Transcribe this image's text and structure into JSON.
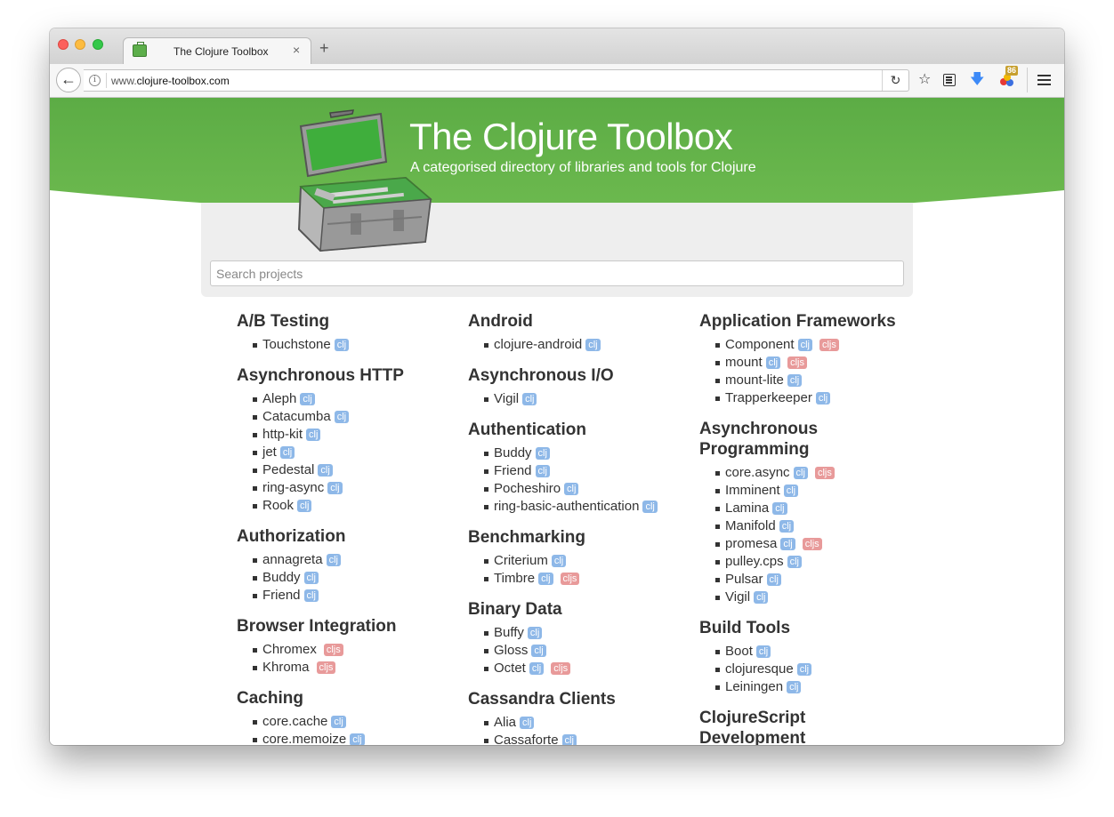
{
  "browser": {
    "tab_title": "The Clojure Toolbox",
    "tab_close": "×",
    "new_tab": "+",
    "url_prefix": "www.",
    "url_domain": "clojure-toolbox.com",
    "extension_badge": "86"
  },
  "banner": {
    "title": "The Clojure Toolbox",
    "subtitle": "A categorised directory of libraries and tools for Clojure",
    "green": "#67b54b"
  },
  "search": {
    "placeholder": "Search projects"
  },
  "tag_colors": {
    "clj": "#8eb8e8",
    "cljs": "#e89a9a"
  },
  "columns": [
    [
      {
        "title": "A/B Testing",
        "projects": [
          {
            "name": "Touchstone",
            "tags": [
              "clj"
            ]
          }
        ]
      },
      {
        "title": "Asynchronous HTTP",
        "projects": [
          {
            "name": "Aleph",
            "tags": [
              "clj"
            ]
          },
          {
            "name": "Catacumba",
            "tags": [
              "clj"
            ]
          },
          {
            "name": "http-kit",
            "tags": [
              "clj"
            ]
          },
          {
            "name": "jet",
            "tags": [
              "clj"
            ]
          },
          {
            "name": "Pedestal",
            "tags": [
              "clj"
            ]
          },
          {
            "name": "ring-async",
            "tags": [
              "clj"
            ]
          },
          {
            "name": "Rook",
            "tags": [
              "clj"
            ]
          }
        ]
      },
      {
        "title": "Authorization",
        "projects": [
          {
            "name": "annagreta",
            "tags": [
              "clj"
            ]
          },
          {
            "name": "Buddy",
            "tags": [
              "clj"
            ]
          },
          {
            "name": "Friend",
            "tags": [
              "clj"
            ]
          }
        ]
      },
      {
        "title": "Browser Integration",
        "projects": [
          {
            "name": "Chromex",
            "tags": [
              "cljs"
            ]
          },
          {
            "name": "Khroma",
            "tags": [
              "cljs"
            ]
          }
        ]
      },
      {
        "title": "Caching",
        "projects": [
          {
            "name": "core.cache",
            "tags": [
              "clj"
            ]
          },
          {
            "name": "core.memoize",
            "tags": [
              "clj"
            ]
          }
        ]
      }
    ],
    [
      {
        "title": "Android",
        "projects": [
          {
            "name": "clojure-android",
            "tags": [
              "clj"
            ]
          }
        ]
      },
      {
        "title": "Asynchronous I/O",
        "projects": [
          {
            "name": "Vigil",
            "tags": [
              "clj"
            ]
          }
        ]
      },
      {
        "title": "Authentication",
        "projects": [
          {
            "name": "Buddy",
            "tags": [
              "clj"
            ]
          },
          {
            "name": "Friend",
            "tags": [
              "clj"
            ]
          },
          {
            "name": "Pocheshiro",
            "tags": [
              "clj"
            ]
          },
          {
            "name": "ring-basic-authentication",
            "tags": [
              "clj"
            ]
          }
        ]
      },
      {
        "title": "Benchmarking",
        "projects": [
          {
            "name": "Criterium",
            "tags": [
              "clj"
            ]
          },
          {
            "name": "Timbre",
            "tags": [
              "clj",
              "cljs"
            ]
          }
        ]
      },
      {
        "title": "Binary Data",
        "projects": [
          {
            "name": "Buffy",
            "tags": [
              "clj"
            ]
          },
          {
            "name": "Gloss",
            "tags": [
              "clj"
            ]
          },
          {
            "name": "Octet",
            "tags": [
              "clj",
              "cljs"
            ]
          }
        ]
      },
      {
        "title": "Cassandra Clients",
        "projects": [
          {
            "name": "Alia",
            "tags": [
              "clj"
            ]
          },
          {
            "name": "Cassaforte",
            "tags": [
              "clj"
            ]
          }
        ]
      }
    ],
    [
      {
        "title": "Application Frameworks",
        "projects": [
          {
            "name": "Component",
            "tags": [
              "clj",
              "cljs"
            ]
          },
          {
            "name": "mount",
            "tags": [
              "clj",
              "cljs"
            ]
          },
          {
            "name": "mount-lite",
            "tags": [
              "clj"
            ]
          },
          {
            "name": "Trapperkeeper",
            "tags": [
              "clj"
            ]
          }
        ]
      },
      {
        "title": "Asynchronous Programming",
        "projects": [
          {
            "name": "core.async",
            "tags": [
              "clj",
              "cljs"
            ]
          },
          {
            "name": "Imminent",
            "tags": [
              "clj"
            ]
          },
          {
            "name": "Lamina",
            "tags": [
              "clj"
            ]
          },
          {
            "name": "Manifold",
            "tags": [
              "clj"
            ]
          },
          {
            "name": "promesa",
            "tags": [
              "clj",
              "cljs"
            ]
          },
          {
            "name": "pulley.cps",
            "tags": [
              "clj"
            ]
          },
          {
            "name": "Pulsar",
            "tags": [
              "clj"
            ]
          },
          {
            "name": "Vigil",
            "tags": [
              "clj"
            ]
          }
        ]
      },
      {
        "title": "Build Tools",
        "projects": [
          {
            "name": "Boot",
            "tags": [
              "clj"
            ]
          },
          {
            "name": "clojuresque",
            "tags": [
              "clj"
            ]
          },
          {
            "name": "Leiningen",
            "tags": [
              "clj"
            ]
          }
        ]
      },
      {
        "title": "ClojureScript Development",
        "projects": []
      }
    ]
  ]
}
